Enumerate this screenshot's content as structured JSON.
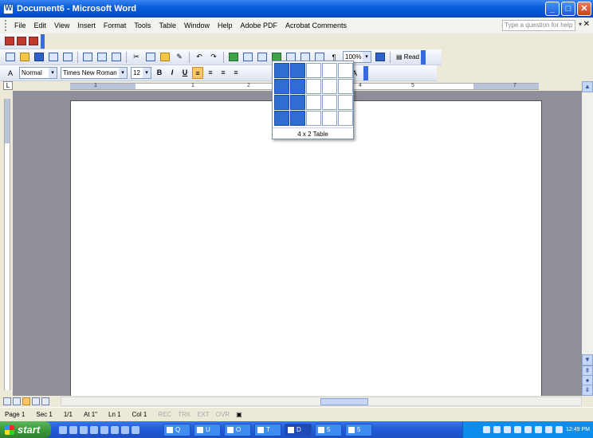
{
  "window": {
    "title": "Document6 - Microsoft Word"
  },
  "menu": {
    "items": [
      "File",
      "Edit",
      "View",
      "Insert",
      "Format",
      "Tools",
      "Table",
      "Window",
      "Help",
      "Adobe PDF",
      "Acrobat Comments"
    ],
    "help_placeholder": "Type a question for help"
  },
  "standard_toolbar": {
    "zoom": "100%",
    "read_label": "Read"
  },
  "formatting_toolbar": {
    "style": "Normal",
    "font": "Times New Roman",
    "size": "12",
    "bold": "B",
    "italic": "I",
    "underline": "U"
  },
  "ruler": {
    "numbers": [
      "1",
      "1",
      "2",
      "4",
      "5",
      "7"
    ]
  },
  "table_popup": {
    "label": "4 x 2 Table",
    "rows": 4,
    "cols": 5,
    "selected_rows": 4,
    "selected_cols": 2
  },
  "status": {
    "page": "Page 1",
    "sec": "Sec 1",
    "pages": "1/1",
    "at": "At 1\"",
    "ln": "Ln 1",
    "col": "Col 1",
    "rec": "REC",
    "trk": "TRK",
    "ext": "EXT",
    "ovr": "OVR"
  },
  "taskbar": {
    "start_label": "start",
    "clock": "12:49 PM",
    "task_buttons": [
      "Q",
      "U",
      "O",
      "T",
      "D",
      "5",
      "5"
    ]
  },
  "colors": {
    "titlebar": "#0a5fd8",
    "selected_cell": "#2f6dd1",
    "start": "#3a9b3a"
  }
}
